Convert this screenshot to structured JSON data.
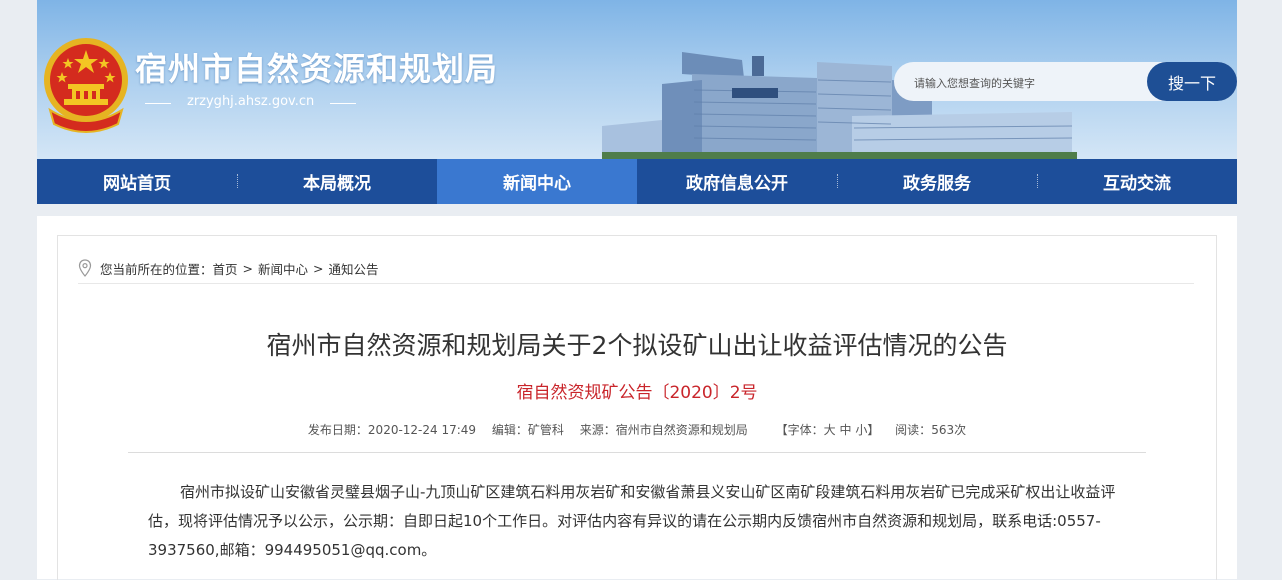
{
  "header": {
    "site_title": "宿州市自然资源和规划局",
    "site_domain": "zrzyghj.ahsz.gov.cn",
    "search_placeholder": "请输入您想查询的关键字",
    "search_button": "搜一下"
  },
  "nav": {
    "items": [
      {
        "label": "网站首页"
      },
      {
        "label": "本局概况"
      },
      {
        "label": "新闻中心"
      },
      {
        "label": "政府信息公开"
      },
      {
        "label": "政务服务"
      },
      {
        "label": "互动交流"
      }
    ],
    "active_index": 2
  },
  "breadcrumb": {
    "prefix": "您当前所在的位置：",
    "items": [
      "首页",
      "新闻中心",
      "通知公告"
    ],
    "separator": ">"
  },
  "article": {
    "title": "宿州市自然资源和规划局关于2个拟设矿山出让收益评估情况的公告",
    "doc_number": "宿自然资规矿公告〔2020〕2号",
    "meta": {
      "publish_date_label": "发布日期：",
      "publish_date": "2020-12-24 17:49",
      "editor_label": "编辑：",
      "editor": "矿管科",
      "source_label": "来源：",
      "source": "宿州市自然资源和规划局",
      "font_label_open": "【字体：",
      "font_sizes": [
        "大",
        "中",
        "小"
      ],
      "font_label_close": "】",
      "views_label": "阅读：",
      "views": "563次"
    },
    "body": "宿州市拟设矿山安徽省灵璧县烟子山-九顶山矿区建筑石料用灰岩矿和安徽省萧县义安山矿区南矿段建筑石料用灰岩矿已完成采矿权出让收益评估，现将评估情况予以公示，公示期：自即日起10个工作日。对评估内容有异议的请在公示期内反馈宿州市自然资源和规划局，联系电话:0557-3937560,邮箱：994495051@qq.com。"
  },
  "colors": {
    "nav_bg": "#1d4e9a",
    "nav_active": "#3a78d0",
    "doc_number": "#c9252b",
    "search_button": "#1e4f95"
  }
}
